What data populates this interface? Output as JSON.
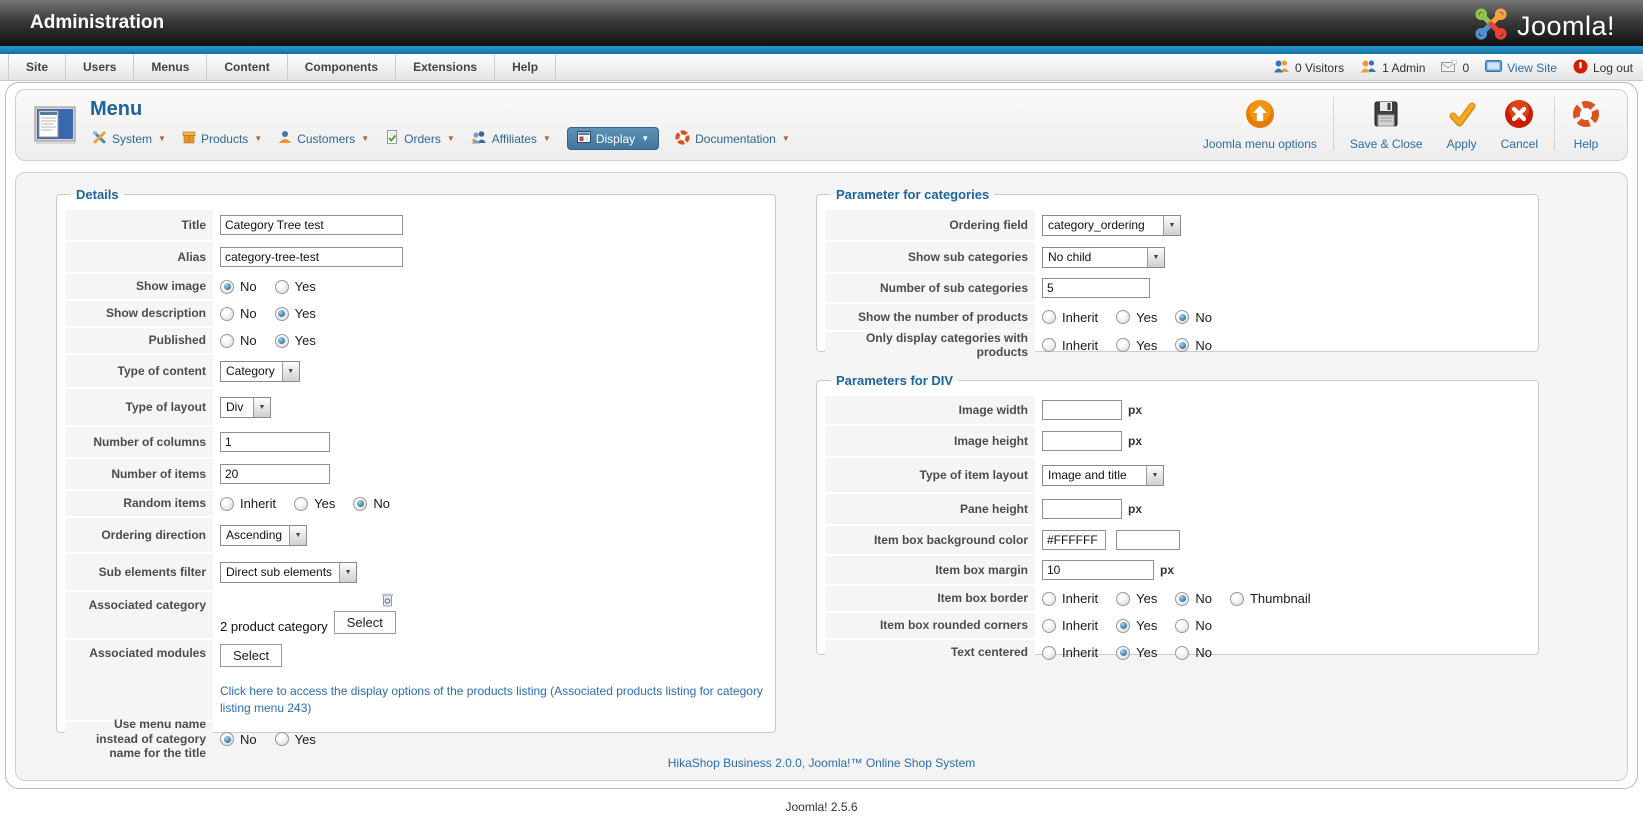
{
  "header": {
    "title": "Administration",
    "logo_text": "Joomla!"
  },
  "menubar": {
    "items": [
      "Site",
      "Users",
      "Menus",
      "Content",
      "Components",
      "Extensions",
      "Help"
    ]
  },
  "status": {
    "visitors": "0 Visitors",
    "admin": "1 Admin",
    "messages": "0",
    "view_site": "View Site",
    "logout": "Log out"
  },
  "page": {
    "title": "Menu"
  },
  "hika": {
    "items": [
      "System",
      "Products",
      "Customers",
      "Orders",
      "Affiliates",
      "Display",
      "Documentation"
    ]
  },
  "toolbar": {
    "options_label": "Joomla menu options",
    "save_close": "Save & Close",
    "apply": "Apply",
    "cancel": "Cancel",
    "help": "Help"
  },
  "common": {
    "no": "No",
    "yes": "Yes",
    "inherit": "Inherit",
    "thumbnail": "Thumbnail",
    "px": "px",
    "select": "Select"
  },
  "details": {
    "legend": "Details",
    "title_label": "Title",
    "title_value": "Category Tree test",
    "alias_label": "Alias",
    "alias_value": "category-tree-test",
    "show_image_label": "Show image",
    "show_description_label": "Show description",
    "published_label": "Published",
    "type_content_label": "Type of content",
    "type_content_value": "Category",
    "type_layout_label": "Type of layout",
    "type_layout_value": "Div",
    "num_columns_label": "Number of columns",
    "num_columns_value": "1",
    "num_items_label": "Number of items",
    "num_items_value": "20",
    "random_items_label": "Random items",
    "ordering_direction_label": "Ordering direction",
    "ordering_direction_value": "Ascending",
    "sub_elements_label": "Sub elements filter",
    "sub_elements_value": "Direct sub elements",
    "associated_category_label": "Associated category",
    "associated_category_text": "2 product category",
    "associated_modules_label": "Associated modules",
    "display_options_link": "Click here to access the display options of the products listing (Associated products listing for category listing menu 243)",
    "use_menu_name_label": "Use menu name instead of category name for the title"
  },
  "cats": {
    "legend": "Parameter for categories",
    "ordering_field_label": "Ordering field",
    "ordering_field_value": "category_ordering",
    "show_sub_label": "Show sub categories",
    "show_sub_value": "No child",
    "num_sub_label": "Number of sub categories",
    "num_sub_value": "5",
    "show_num_label": "Show the number of products",
    "only_display_label": "Only display categories with products"
  },
  "divp": {
    "legend": "Parameters for DIV",
    "image_width_label": "Image width",
    "image_height_label": "Image height",
    "type_item_label": "Type of item layout",
    "type_item_value": "Image and title",
    "pane_height_label": "Pane height",
    "item_bg_label": "Item box background color",
    "item_bg_value": "#FFFFFF",
    "item_margin_label": "Item box margin",
    "item_margin_value": "10",
    "item_border_label": "Item box border",
    "item_rounded_label": "Item box rounded corners",
    "text_centered_label": "Text centered"
  },
  "footer": {
    "hikashop": "HikaShop Business 2.0.0, Joomla!™ Online Shop System",
    "version": "Joomla! 2.5.6"
  }
}
